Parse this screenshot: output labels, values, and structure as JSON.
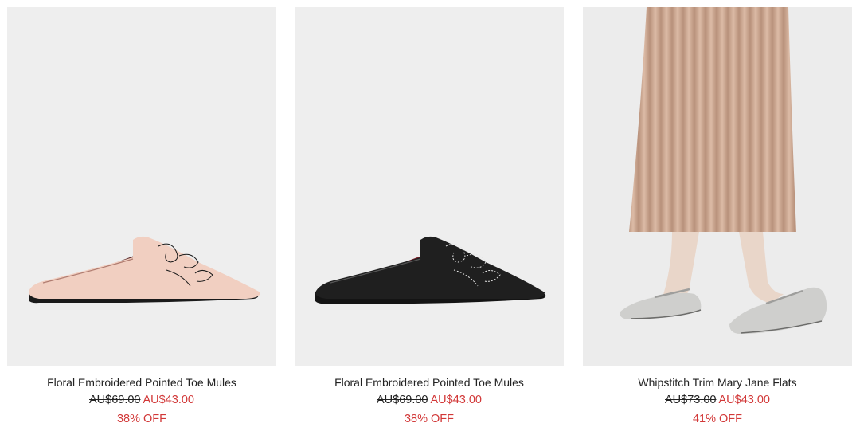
{
  "products": [
    {
      "name": "Floral Embroidered Pointed Toe Mules",
      "old_price": "AU$69.00",
      "sale_price": "AU$43.00",
      "discount": "38% OFF",
      "image_icon": "pink-mule-shoe-image"
    },
    {
      "name": "Floral Embroidered Pointed Toe Mules",
      "old_price": "AU$69.00",
      "sale_price": "AU$43.00",
      "discount": "38% OFF",
      "image_icon": "black-mule-shoe-image"
    },
    {
      "name": "Whipstitch Trim Mary Jane Flats",
      "old_price": "AU$73.00",
      "sale_price": "AU$43.00",
      "discount": "41% OFF",
      "image_icon": "model-wearing-mary-jane-flats-image"
    }
  ],
  "colors": {
    "image_bg": "#eeeeee",
    "sale_red": "#d23838",
    "text": "#222222",
    "pink_leather": "#f1cfc1",
    "black_leather": "#1f1f1f",
    "skirt": "#c9a48e",
    "silver_flat": "#cfcfcd"
  }
}
